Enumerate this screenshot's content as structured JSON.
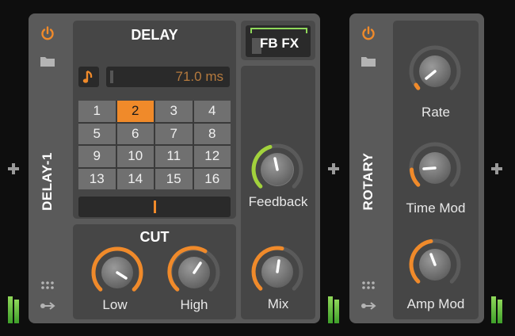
{
  "colors": {
    "accent": "#f08a2a",
    "green": "#8fd85a",
    "panel": "#464646",
    "device": "#5a5a5a"
  },
  "delay": {
    "name": "DELAY-1",
    "title": "DELAY",
    "time_value": "71.0 ms",
    "grid": [
      "1",
      "2",
      "3",
      "4",
      "5",
      "6",
      "7",
      "8",
      "9",
      "10",
      "11",
      "12",
      "13",
      "14",
      "15",
      "16"
    ],
    "selected": "2",
    "fbfx_label": "FB FX",
    "cut_title": "CUT",
    "knobs": {
      "low": "Low",
      "high": "High",
      "feedback": "Feedback",
      "mix": "Mix"
    }
  },
  "rotary": {
    "name": "ROTARY",
    "knobs": {
      "rate": "Rate",
      "time_mod": "Time Mod",
      "amp_mod": "Amp Mod"
    }
  },
  "icons": [
    "power-icon",
    "folder-icon",
    "grid-dots-icon",
    "routing-arrow-icon",
    "plus-icon",
    "note-icon"
  ]
}
